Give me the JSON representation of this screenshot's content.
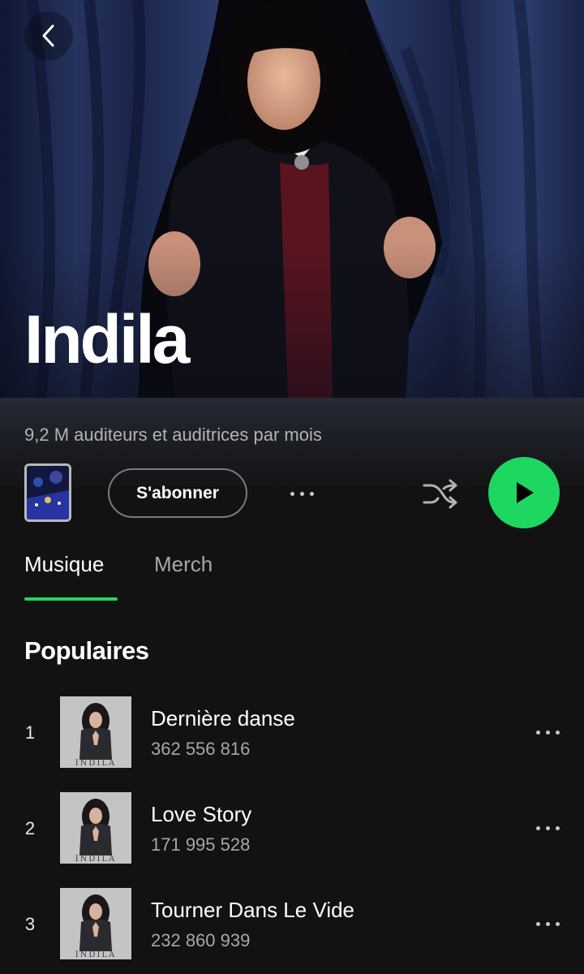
{
  "artist": {
    "name": "Indila",
    "monthly_listeners": "9,2 M auditeurs et auditrices par mois"
  },
  "actions": {
    "follow_label": "S'abonner"
  },
  "tabs": [
    {
      "label": "Musique",
      "active": true
    },
    {
      "label": "Merch",
      "active": false
    }
  ],
  "popular": {
    "title": "Populaires",
    "tracks": [
      {
        "rank": "1",
        "title": "Dernière danse",
        "plays": "362 556 816",
        "cover_text": "INDILA"
      },
      {
        "rank": "2",
        "title": "Love Story",
        "plays": "171 995 528",
        "cover_text": "INDILA"
      },
      {
        "rank": "3",
        "title": "Tourner Dans Le Vide",
        "plays": "232 860 939",
        "cover_text": "INDILA"
      }
    ]
  },
  "icons": {
    "back": "chevron-left-icon",
    "more": "more-horizontal-icon",
    "shuffle": "shuffle-icon",
    "play": "play-icon"
  },
  "colors": {
    "accent": "#1ed760",
    "background": "#121212",
    "muted_text": "#a7a7a7"
  }
}
